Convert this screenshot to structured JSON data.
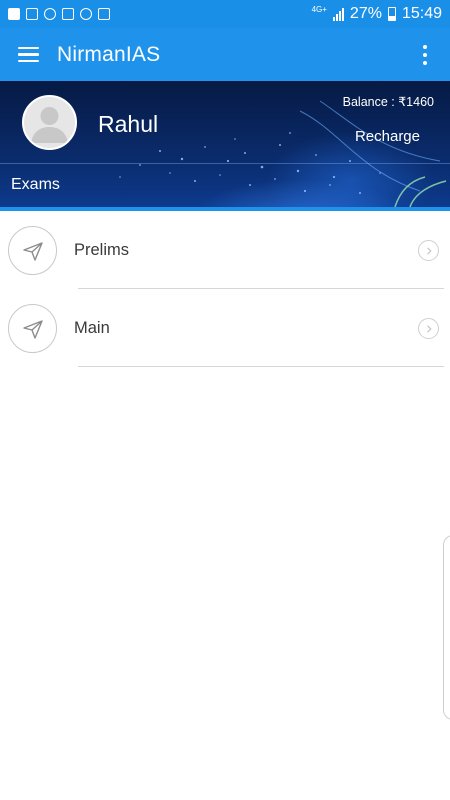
{
  "status_bar": {
    "network": "4G+",
    "battery": "27%",
    "time": "15:49"
  },
  "app_bar": {
    "title": "NirmanIAS",
    "menu_icon": "hamburger-menu-icon",
    "more_icon": "more-vert-icon"
  },
  "header": {
    "username": "Rahul",
    "balance": "Balance : ₹1460",
    "recharge_label": "Recharge",
    "section_label": "Exams"
  },
  "list": {
    "items": [
      {
        "label": "Prelims",
        "icon": "paper-plane-icon"
      },
      {
        "label": "Main",
        "icon": "paper-plane-icon"
      }
    ]
  },
  "colors": {
    "primary": "#1f93ec",
    "status_bar": "#1a8fe8",
    "banner_dark": "#061a44",
    "text": "#3a3a3a"
  }
}
